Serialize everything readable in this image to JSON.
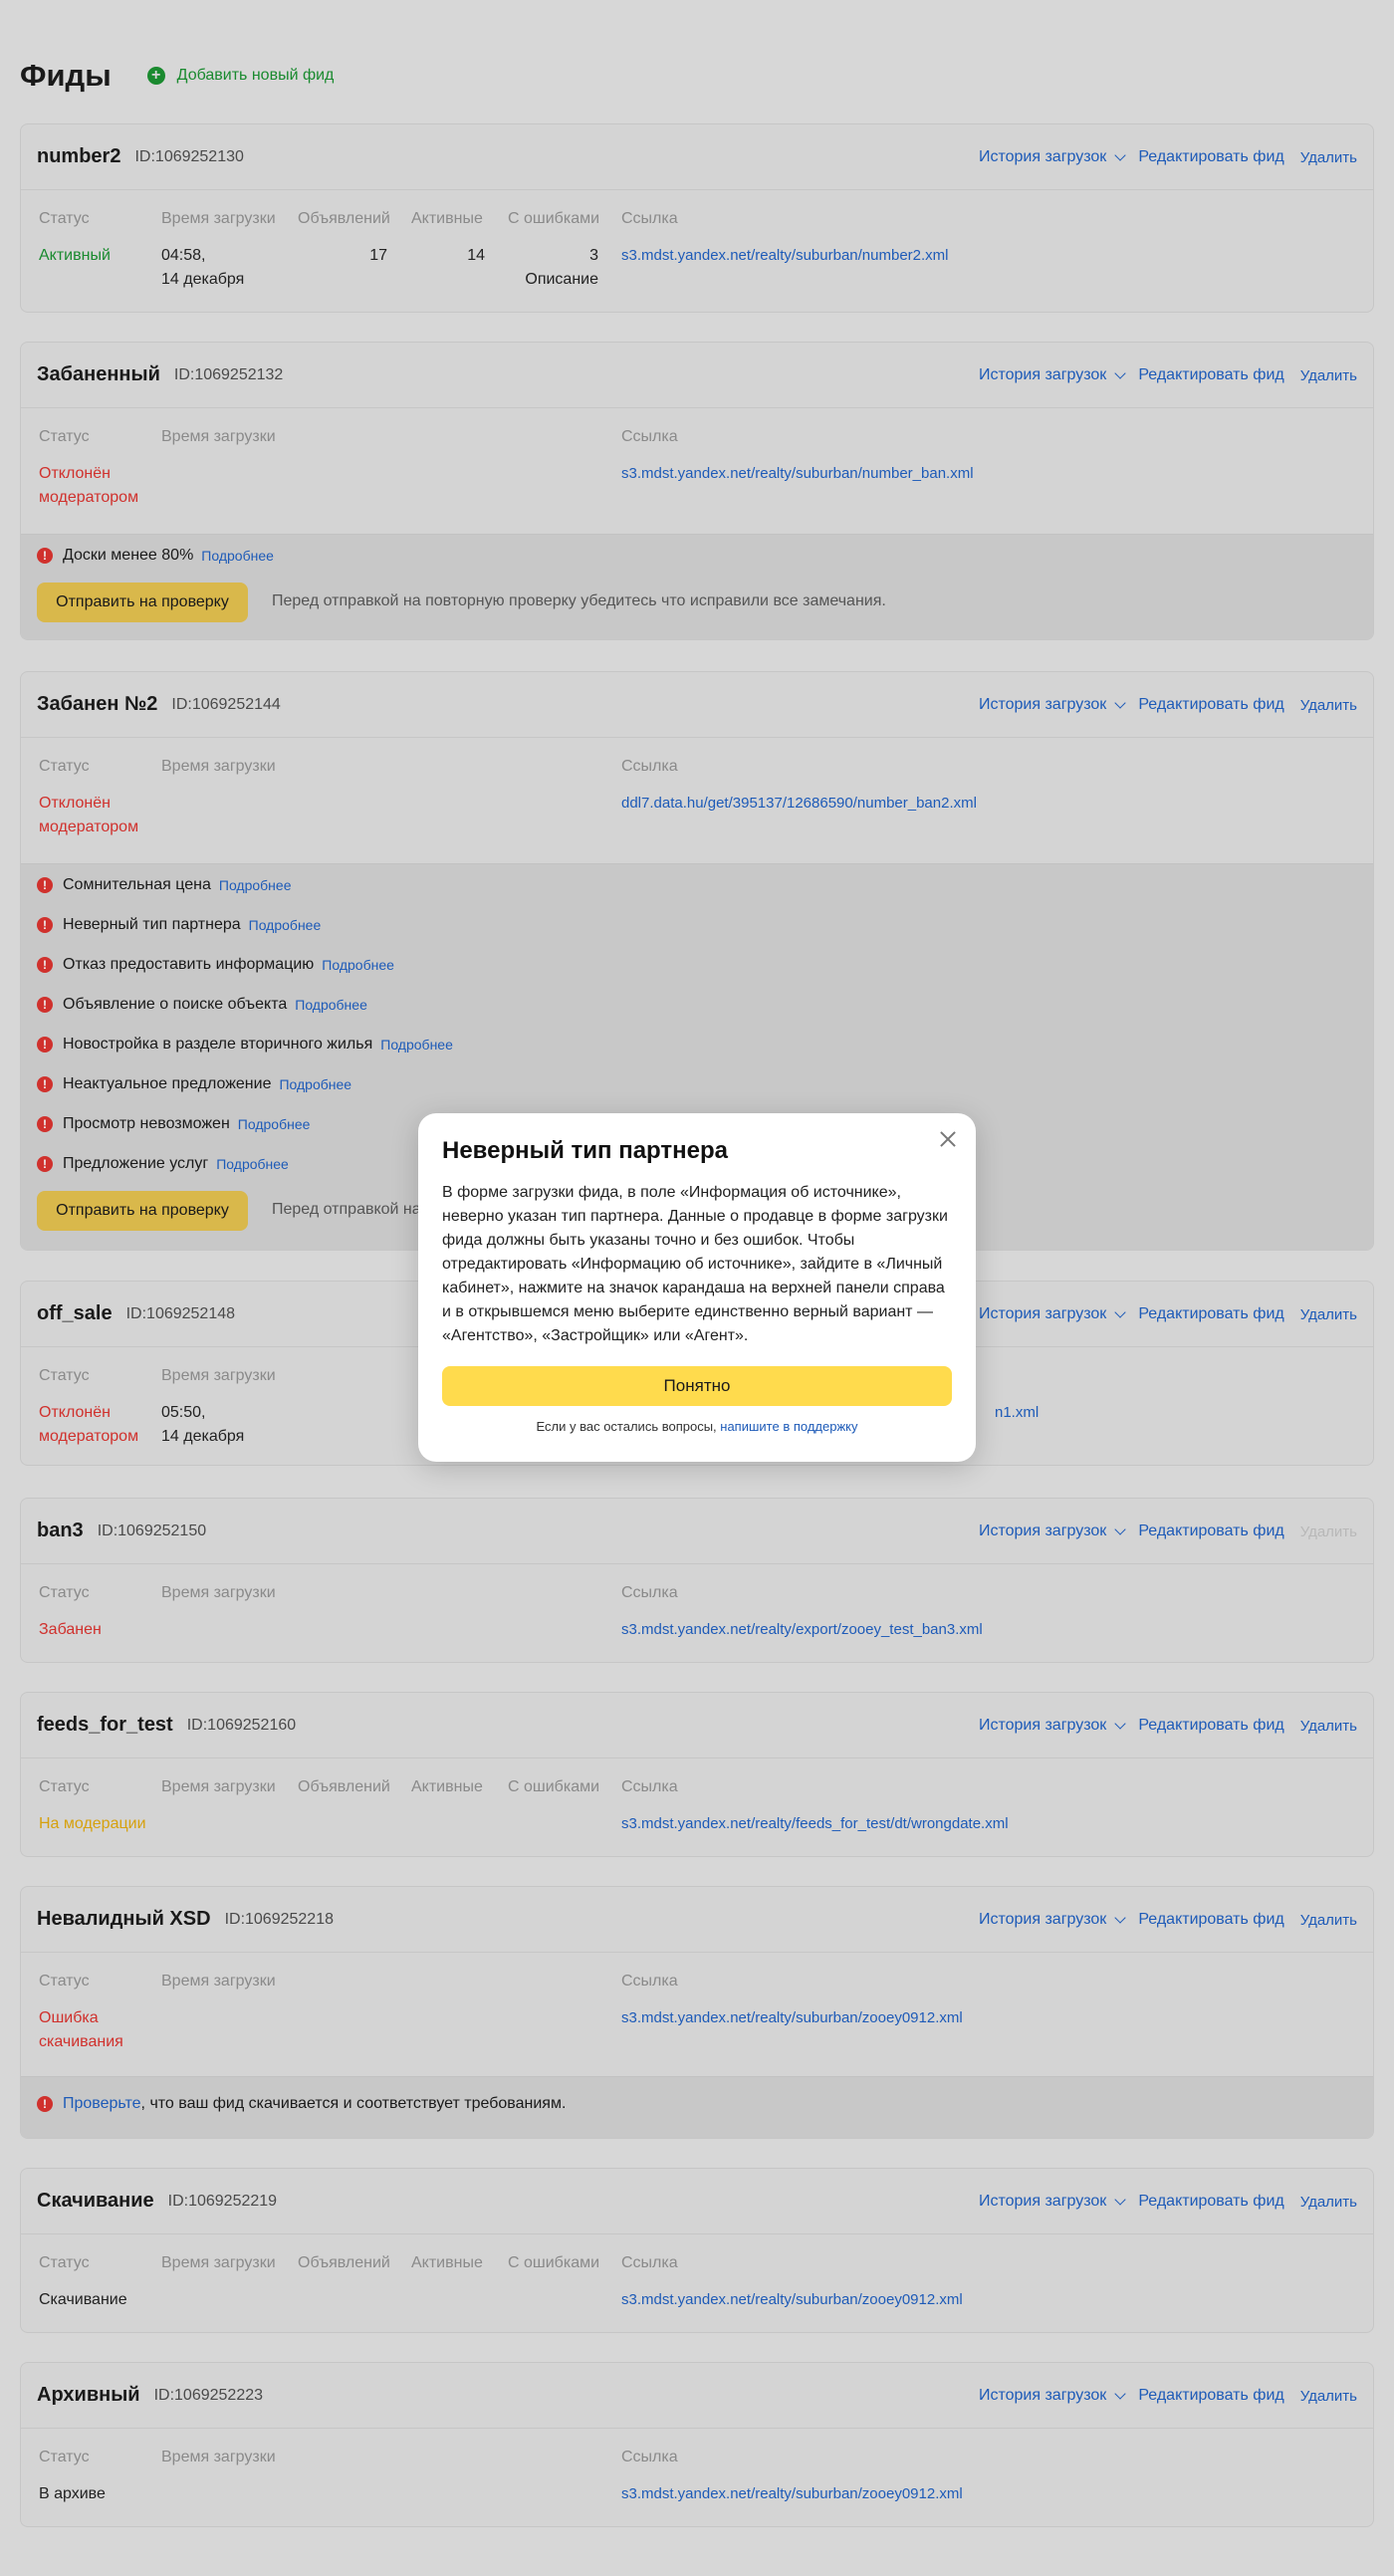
{
  "page": {
    "title": "Фиды",
    "add_feed_label": "Добавить новый фид"
  },
  "common": {
    "history": "История загрузок",
    "edit": "Редактировать фид",
    "delete": "Удалить",
    "more": "Подробнее",
    "recheck_button": "Отправить на проверку",
    "recheck_note": "Перед отправкой на повторную проверку убедитесь что исправили все замечания.",
    "recheck_note_short": "Перед отправкой на",
    "columns": {
      "status": "Статус",
      "time": "Время загрузки",
      "ads": "Объявлений",
      "active": "Активные",
      "errors": "С ошибками",
      "link": "Ссылка"
    }
  },
  "feeds": [
    {
      "name": "number2",
      "id": "ID:1069252130",
      "status": "Активный",
      "time_1": "04:58,",
      "time_2": "14 декабря",
      "ads": "17",
      "active": "14",
      "errors": "3",
      "errors_note": "Описание",
      "link": "s3.mdst.yandex.net/realty/suburban/number2.xml"
    },
    {
      "name": "Забаненный",
      "id": "ID:1069252132",
      "status_1": "Отклонён",
      "status_2": "модератором",
      "link": "s3.mdst.yandex.net/realty/suburban/number_ban.xml",
      "issues": [
        "Доски менее 80%"
      ]
    },
    {
      "name": "Забанен №2",
      "id": "ID:1069252144",
      "status_1": "Отклонён",
      "status_2": "модератором",
      "link": "ddl7.data.hu/get/395137/12686590/number_ban2.xml",
      "issues": [
        "Сомнительная цена",
        "Неверный тип партнера",
        "Отказ предоставить информацию",
        "Объявление о поиске объекта",
        "Новостройка в разделе вторичного жилья",
        "Неактуальное предложение",
        "Просмотр невозможен",
        "Предложение услуг"
      ]
    },
    {
      "name": "off_sale",
      "id": "ID:1069252148",
      "status_1": "Отклонён",
      "status_2": "модератором",
      "time_1": "05:50,",
      "time_2": "14 декабря",
      "link_visible": "n1.xml"
    },
    {
      "name": "ban3",
      "id": "ID:1069252150",
      "status": "Забанен",
      "link": "s3.mdst.yandex.net/realty/export/zooey_test_ban3.xml"
    },
    {
      "name": "feeds_for_test",
      "id": "ID:1069252160",
      "status": "На модерации",
      "link": "s3.mdst.yandex.net/realty/feeds_for_test/dt/wrongdate.xml"
    },
    {
      "name": "Невалидный XSD",
      "id": "ID:1069252218",
      "status_1": "Ошибка",
      "status_2": "скачивания",
      "link": "s3.mdst.yandex.net/realty/suburban/zooey0912.xml",
      "issue_link": "Проверьте",
      "issue_text": ", что ваш фид скачивается и соответствует требованиям."
    },
    {
      "name": "Скачивание",
      "id": "ID:1069252219",
      "status": "Скачивание",
      "link": "s3.mdst.yandex.net/realty/suburban/zooey0912.xml"
    },
    {
      "name": "Архивный",
      "id": "ID:1069252223",
      "status": "В архиве",
      "link": "s3.mdst.yandex.net/realty/suburban/zooey0912.xml"
    }
  ],
  "modal": {
    "title": "Неверный тип партнера",
    "text": "В форме загрузки фида, в поле «Информация об источнике», неверно указан тип партнера. Данные о продавце в форме загрузки фида должны быть указаны точно и без ошибок. Чтобы отредактировать «Информацию об источнике», зайдите в «Личный кабинет», нажмите на значок карандаша на верхней панели справа и в открывшемся меню выберите единственно верный вариант — «Агентство», «Застройщик» или «Агент».",
    "button": "Понятно",
    "footer_text": "Если у вас остались вопросы, ",
    "footer_link": "напишите в поддержку"
  },
  "colors": {
    "accent_link": "#1e5bb8",
    "status_green": "#1a8a2f",
    "status_red": "#d0312d",
    "status_orange": "#d6a10f",
    "button_yellow": "#ffdb4d"
  }
}
